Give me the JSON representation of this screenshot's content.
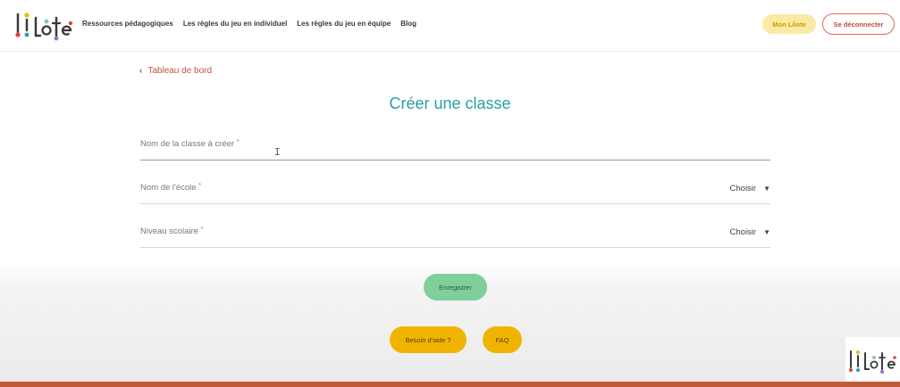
{
  "header": {
    "logo_label": "Lilote",
    "nav": [
      "Ressources pédagogiques",
      "Les règles du jeu en individuel",
      "Les règles du jeu en équipe",
      "Blog"
    ],
    "mon_lilote": "Mon Lilote",
    "logout": "Se déconnecter"
  },
  "main": {
    "breadcrumb": "Tableau de bord",
    "title": "Créer une classe",
    "fields": {
      "class_name": {
        "label": "Nom de la classe à créer",
        "required": "*",
        "value": ""
      },
      "school": {
        "label": "Nom de l'école",
        "required": "*",
        "selected": "Choisir"
      },
      "level": {
        "label": "Niveau scolaire",
        "required": "*",
        "selected": "Choisir"
      }
    },
    "save": "Enregistrer"
  },
  "footer": {
    "help": "Besoin d'aide ?",
    "faq": "FAQ"
  },
  "colors": {
    "accent_title": "#2a9fa8",
    "save_green": "#7fcf9a",
    "help_yellow": "#f0b400",
    "breadcrumb_red": "#c0553f",
    "bottom_bar": "#c45a3c"
  },
  "icons": [
    "lilote-logo",
    "chevron-left-icon",
    "caret-down-icon",
    "text-cursor-icon"
  ]
}
